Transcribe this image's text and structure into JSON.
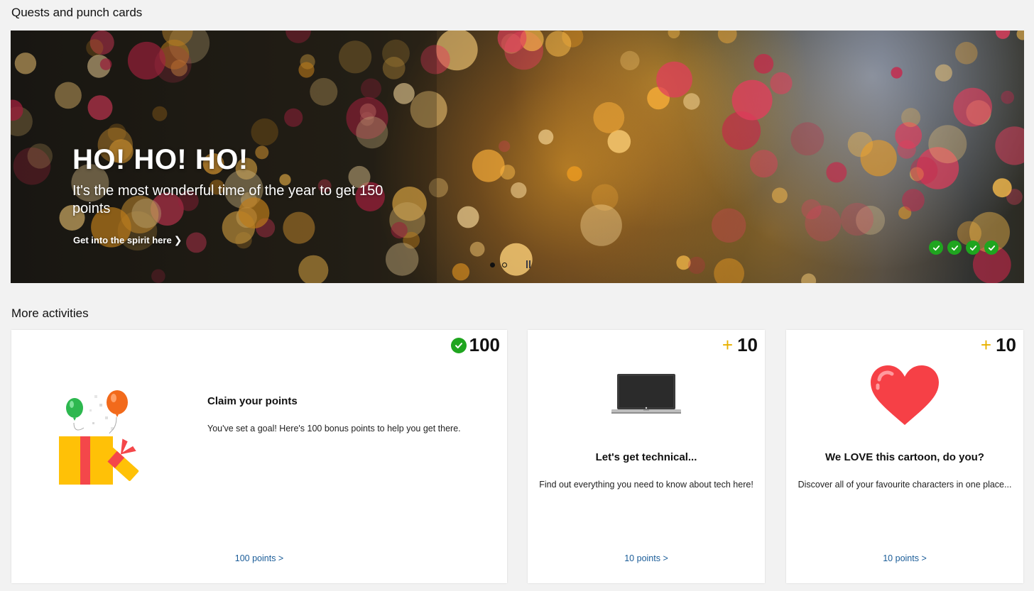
{
  "sections": {
    "quests_title": "Quests and punch cards",
    "more_title": "More activities"
  },
  "hero": {
    "heading": "HO! HO! HO!",
    "subtitle": "It's the most wonderful time of the year to get 150 points",
    "link_label": "Get into the spirit here",
    "link_chevron": "❯",
    "checks_completed": 4,
    "carousel_slides": 2,
    "carousel_active_slide": 1
  },
  "cards": [
    {
      "points": "100",
      "status": "completed",
      "title": "Claim your points",
      "description": "You've set a goal! Here's 100 bonus points to help you get there.",
      "link": "100 points >",
      "icon": "gift-balloons-icon"
    },
    {
      "points": "10",
      "plus": "+",
      "status": "available",
      "title": "Let's get technical...",
      "description": "Find out everything you need to know about tech here!",
      "link": "10 points >",
      "icon": "laptop-icon"
    },
    {
      "points": "10",
      "plus": "+",
      "status": "available",
      "title": "We LOVE this cartoon, do you?",
      "description": "Discover all of your favourite characters in one place...",
      "link": "10 points >",
      "icon": "heart-icon"
    }
  ],
  "colors": {
    "accent_link": "#1a5c98",
    "check_green": "#1fa51f",
    "plus_gold": "#e8b100",
    "background": "#f2f2f2"
  }
}
